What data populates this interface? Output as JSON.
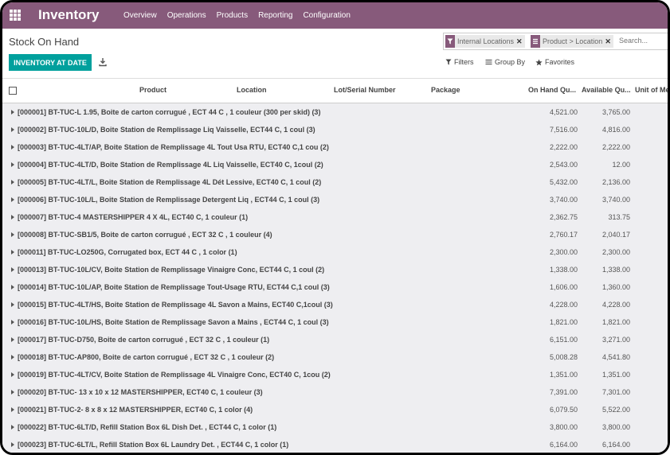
{
  "app": {
    "title": "Inventory"
  },
  "menu": [
    "Overview",
    "Operations",
    "Products",
    "Reporting",
    "Configuration"
  ],
  "breadcrumb": "Stock On Hand",
  "buttons": {
    "inventory_at_date": "INVENTORY AT DATE"
  },
  "search": {
    "facets": [
      "Internal Locations",
      "Product > Location"
    ],
    "placeholder": "Search..."
  },
  "tools": {
    "filters": "Filters",
    "group_by": "Group By",
    "favorites": "Favorites"
  },
  "columns": {
    "product": "Product",
    "location": "Location",
    "lot": "Lot/Serial Number",
    "package": "Package",
    "onhand": "On Hand Qu...",
    "available": "Available Qu...",
    "uom": "Unit of Me"
  },
  "rows": [
    {
      "label": "[000001] BT-TUC-L 1.95, Boite de carton corrugué , ECT 44 C , 1 couleur (300 per skid) (3)",
      "onhand": "4,521.00",
      "available": "3,765.00"
    },
    {
      "label": "[000002] BT-TUC-10L/D, Boite Station de Remplissage Liq Vaisselle, ECT44 C, 1 coul (3)",
      "onhand": "7,516.00",
      "available": "4,816.00"
    },
    {
      "label": "[000003] BT-TUC-4LT/AP, Boite Station de Remplissage 4L Tout Usa RTU, ECT40 C,1 cou (2)",
      "onhand": "2,222.00",
      "available": "2,222.00"
    },
    {
      "label": "[000004] BT-TUC-4LT/D, Boite Station de Remplissage 4L Liq Vaisselle, ECT40 C, 1coul (2)",
      "onhand": "2,543.00",
      "available": "12.00"
    },
    {
      "label": "[000005] BT-TUC-4LT/L, Boite Station de Remplissage 4L Dét Lessive, ECT40 C, 1 coul (2)",
      "onhand": "5,432.00",
      "available": "2,136.00"
    },
    {
      "label": "[000006] BT-TUC-10L/L, Boite Station de Remplissage Detergent Liq , ECT44 C, 1 coul (3)",
      "onhand": "3,740.00",
      "available": "3,740.00"
    },
    {
      "label": "[000007] BT-TUC-4 MASTERSHIPPER 4 X 4L, ECT40 C, 1 couleur (1)",
      "onhand": "2,362.75",
      "available": "313.75"
    },
    {
      "label": "[000008] BT-TUC-SB1/5, Boite de carton corrugué , ECT 32 C , 1 couleur (4)",
      "onhand": "2,760.17",
      "available": "2,040.17"
    },
    {
      "label": "[000011] BT-TUC-LO250G, Corrugated box, ECT 44 C , 1 color (1)",
      "onhand": "2,300.00",
      "available": "2,300.00"
    },
    {
      "label": "[000013] BT-TUC-10L/CV, Boite Station de Remplissage Vinaigre Conc, ECT44 C, 1 coul (2)",
      "onhand": "1,338.00",
      "available": "1,338.00"
    },
    {
      "label": "[000014] BT-TUC-10L/AP, Boite Station de Remplissage Tout-Usage RTU, ECT44 C,1 coul (3)",
      "onhand": "1,606.00",
      "available": "1,360.00"
    },
    {
      "label": "[000015] BT-TUC-4LT/HS, Boite Station de Remplissage 4L Savon a Mains, ECT40 C,1coul (3)",
      "onhand": "4,228.00",
      "available": "4,228.00"
    },
    {
      "label": "[000016] BT-TUC-10L/HS, Boite Station de Remplissage Savon a Mains , ECT44 C, 1 coul (3)",
      "onhand": "1,821.00",
      "available": "1,821.00"
    },
    {
      "label": "[000017] BT-TUC-D750, Boite de carton corrugué , ECT 32 C , 1 couleur (1)",
      "onhand": "6,151.00",
      "available": "3,271.00"
    },
    {
      "label": "[000018] BT-TUC-AP800, Boite de carton corrugué , ECT 32 C , 1 couleur (2)",
      "onhand": "5,008.28",
      "available": "4,541.80"
    },
    {
      "label": "[000019] BT-TUC-4LT/CV, Boite Station de Remplissage 4L Vinaigre Conc, ECT40 C, 1cou (2)",
      "onhand": "1,351.00",
      "available": "1,351.00"
    },
    {
      "label": "[000020] BT-TUC- 13 x 10 x 12 MASTERSHIPPER, ECT40 C, 1 couleur (3)",
      "onhand": "7,391.00",
      "available": "7,301.00"
    },
    {
      "label": "[000021] BT-TUC-2- 8 x 8 x 12 MASTERSHIPPER, ECT40 C, 1 color (4)",
      "onhand": "6,079.50",
      "available": "5,522.00"
    },
    {
      "label": "[000022] BT-TUC-6LT/D, Refill Station Box 6L Dish Det. , ECT44 C, 1 color (1)",
      "onhand": "3,800.00",
      "available": "3,800.00"
    },
    {
      "label": "[000023] BT-TUC-6LT/L, Refill Station Box 6L Laundry Det. , ECT44 C, 1 color (1)",
      "onhand": "6,164.00",
      "available": "6,164.00"
    }
  ],
  "colors": {
    "brand": "#875A7B",
    "primary_button": "#00A09D",
    "row_bg": "#eeeef1"
  },
  "icons": {
    "apps": "apps-grid-icon",
    "download": "download-icon",
    "filter": "filter-icon",
    "group_by": "list-icon",
    "favorites": "star-icon",
    "remove": "close-icon"
  }
}
